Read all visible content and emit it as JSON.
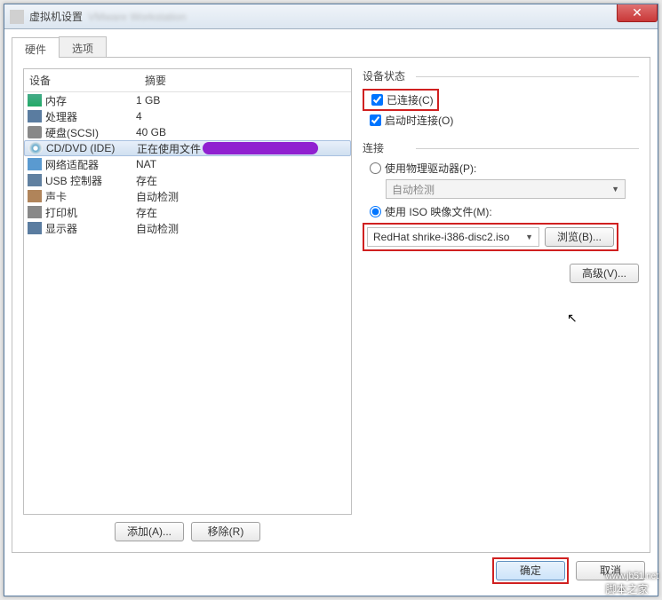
{
  "window": {
    "title": "虚拟机设置"
  },
  "tabs": {
    "hardware": "硬件",
    "options": "选项"
  },
  "columns": {
    "device": "设备",
    "summary": "摘要"
  },
  "hw": [
    {
      "name": "内存",
      "summary": "1 GB",
      "ico": "ico-mem"
    },
    {
      "name": "处理器",
      "summary": "4",
      "ico": "ico-cpu"
    },
    {
      "name": "硬盘(SCSI)",
      "summary": "40 GB",
      "ico": "ico-hdd"
    },
    {
      "name": "CD/DVD (IDE)",
      "summary": "正在使用文件",
      "ico": "ico-cd",
      "sel": true,
      "purple": true
    },
    {
      "name": "网络适配器",
      "summary": "NAT",
      "ico": "ico-net"
    },
    {
      "name": "USB 控制器",
      "summary": "存在",
      "ico": "ico-usb"
    },
    {
      "name": "声卡",
      "summary": "自动检测",
      "ico": "ico-snd"
    },
    {
      "name": "打印机",
      "summary": "存在",
      "ico": "ico-prn"
    },
    {
      "name": "显示器",
      "summary": "自动检测",
      "ico": "ico-disp"
    }
  ],
  "buttons": {
    "add": "添加(A)...",
    "remove": "移除(R)",
    "browse": "浏览(B)...",
    "advanced": "高级(V)...",
    "ok": "确定",
    "cancel": "取消"
  },
  "status": {
    "title": "设备状态",
    "connected": "已连接(C)",
    "connect_at_poweron": "启动时连接(O)"
  },
  "connection": {
    "title": "连接",
    "use_physical": "使用物理驱动器(P):",
    "physical_value": "自动检测",
    "use_iso": "使用 ISO 映像文件(M):",
    "iso_value": "RedHat shrike-i386-disc2.iso"
  },
  "watermark": {
    "url": "www.jb51.net",
    "text": "脚本之家"
  }
}
